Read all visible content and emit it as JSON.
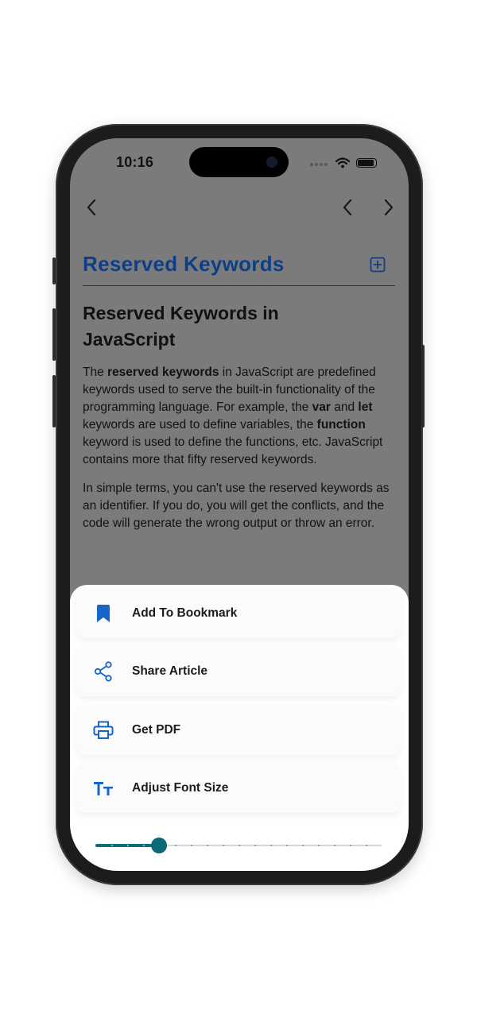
{
  "status_bar": {
    "time": "10:16"
  },
  "article": {
    "title": "Reserved Keywords",
    "heading": "Reserved Keywords in JavaScript",
    "paragraph1": [
      {
        "text": "The ",
        "bold": false
      },
      {
        "text": "reserved keywords",
        "bold": true
      },
      {
        "text": " in JavaScript are predefined keywords used to serve the built-in functionality of the programming language. For example, the ",
        "bold": false
      },
      {
        "text": "var",
        "bold": true
      },
      {
        "text": " and ",
        "bold": false
      },
      {
        "text": "let",
        "bold": true
      },
      {
        "text": " keywords are used to define variables, the ",
        "bold": false
      },
      {
        "text": "function",
        "bold": true
      },
      {
        "text": " keyword is used to define the functions, etc. JavaScript contains more that fifty reserved keywords.",
        "bold": false
      }
    ],
    "paragraph2": "In simple terms, you can't use the reserved keywords as an identifier. If you do, you will get the conflicts, and the code will generate the wrong output or throw an error."
  },
  "sheet": {
    "items": [
      {
        "label": "Add To Bookmark",
        "icon": "bookmark-icon"
      },
      {
        "label": "Share Article",
        "icon": "share-icon"
      },
      {
        "label": "Get PDF",
        "icon": "printer-icon"
      },
      {
        "label": "Adjust Font Size",
        "icon": "font-size-icon"
      }
    ],
    "font_slider": {
      "value": 4,
      "max": 18
    }
  },
  "colors": {
    "accent": "#1765c8",
    "title_blue": "#0e3f86",
    "slider": "#0b6b78",
    "overlay": "#7b7b7b"
  }
}
